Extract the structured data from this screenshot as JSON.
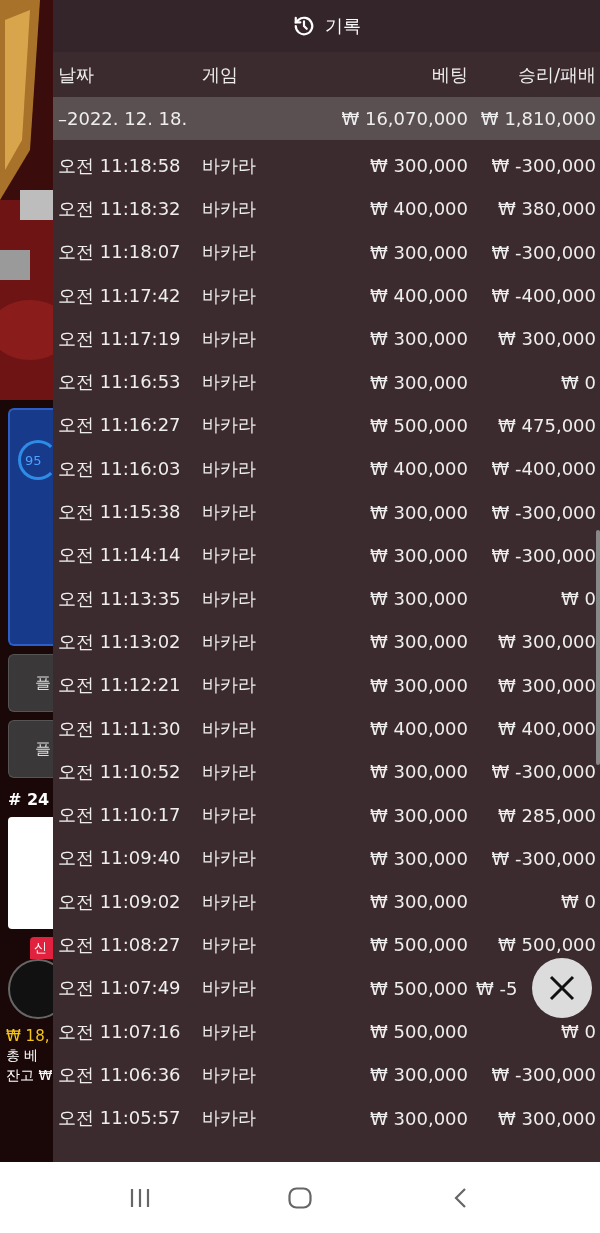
{
  "background_app": {
    "progress_label": "95",
    "button_1": "플",
    "button_2": "플",
    "round": "# 24",
    "badge": "신",
    "amount": "₩ 18,",
    "total_bet_label": "총 베",
    "balance_label": "잔고 ₩"
  },
  "panel": {
    "title": "기록",
    "columns": [
      "날짜",
      "게임",
      "베팅",
      "승리/패배"
    ],
    "date_group": {
      "date": "–2022. 12. 18.",
      "bet": "₩ 16,070,000",
      "result": "₩ 1,810,000"
    },
    "rows": [
      {
        "time": "오전 11:18:58",
        "game": "바카라",
        "bet": "₩ 300,000",
        "result": "₩ -300,000"
      },
      {
        "time": "오전 11:18:32",
        "game": "바카라",
        "bet": "₩ 400,000",
        "result": "₩ 380,000"
      },
      {
        "time": "오전 11:18:07",
        "game": "바카라",
        "bet": "₩ 300,000",
        "result": "₩ -300,000"
      },
      {
        "time": "오전 11:17:42",
        "game": "바카라",
        "bet": "₩ 400,000",
        "result": "₩ -400,000"
      },
      {
        "time": "오전 11:17:19",
        "game": "바카라",
        "bet": "₩ 300,000",
        "result": "₩ 300,000"
      },
      {
        "time": "오전 11:16:53",
        "game": "바카라",
        "bet": "₩ 300,000",
        "result": "₩ 0"
      },
      {
        "time": "오전 11:16:27",
        "game": "바카라",
        "bet": "₩ 500,000",
        "result": "₩ 475,000"
      },
      {
        "time": "오전 11:16:03",
        "game": "바카라",
        "bet": "₩ 400,000",
        "result": "₩ -400,000"
      },
      {
        "time": "오전 11:15:38",
        "game": "바카라",
        "bet": "₩ 300,000",
        "result": "₩ -300,000"
      },
      {
        "time": "오전 11:14:14",
        "game": "바카라",
        "bet": "₩ 300,000",
        "result": "₩ -300,000"
      },
      {
        "time": "오전 11:13:35",
        "game": "바카라",
        "bet": "₩ 300,000",
        "result": "₩ 0"
      },
      {
        "time": "오전 11:13:02",
        "game": "바카라",
        "bet": "₩ 300,000",
        "result": "₩ 300,000"
      },
      {
        "time": "오전 11:12:21",
        "game": "바카라",
        "bet": "₩ 300,000",
        "result": "₩ 300,000"
      },
      {
        "time": "오전 11:11:30",
        "game": "바카라",
        "bet": "₩ 400,000",
        "result": "₩ 400,000"
      },
      {
        "time": "오전 11:10:52",
        "game": "바카라",
        "bet": "₩ 300,000",
        "result": "₩ -300,000"
      },
      {
        "time": "오전 11:10:17",
        "game": "바카라",
        "bet": "₩ 300,000",
        "result": "₩ 285,000"
      },
      {
        "time": "오전 11:09:40",
        "game": "바카라",
        "bet": "₩ 300,000",
        "result": "₩ -300,000"
      },
      {
        "time": "오전 11:09:02",
        "game": "바카라",
        "bet": "₩ 300,000",
        "result": "₩ 0"
      },
      {
        "time": "오전 11:08:27",
        "game": "바카라",
        "bet": "₩ 500,000",
        "result": "₩ 500,000"
      },
      {
        "time": "오전 11:07:49",
        "game": "바카라",
        "bet": "₩ 500,000",
        "result": "₩ -5",
        "kind": "partly_hidden"
      },
      {
        "time": "오전 11:07:16",
        "game": "바카라",
        "bet": "₩ 500,000",
        "result": "₩ 0"
      },
      {
        "time": "오전 11:06:36",
        "game": "바카라",
        "bet": "₩ 300,000",
        "result": "₩ -300,000"
      },
      {
        "time": "오전 11:05:57",
        "game": "바카라",
        "bet": "₩ 300,000",
        "result": "₩ 300,000"
      }
    ]
  }
}
